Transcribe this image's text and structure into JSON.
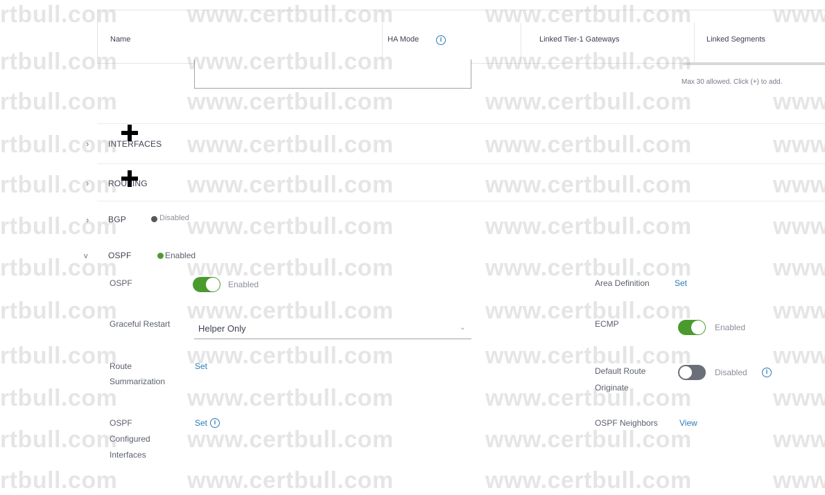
{
  "table_header": {
    "name": "Name",
    "ha_mode": "HA Mode",
    "linked_tier1": "Linked Tier-1 Gateways",
    "linked_segments": "Linked Segments"
  },
  "hint": "Max 30 allowed. Click (+) to add.",
  "sections": {
    "interfaces": "INTERFACES",
    "routing": "ROUTING",
    "bgp": {
      "title": "BGP",
      "status": "Disabled"
    },
    "ospf": {
      "title": "OSPF",
      "status": "Enabled"
    }
  },
  "ospf_form": {
    "ospf_label": "OSPF",
    "ospf_toggle": "Enabled",
    "graceful_label": "Graceful Restart",
    "graceful_value": "Helper Only",
    "route_label_1": "Route",
    "route_label_2": "Summarization",
    "route_link": "Set",
    "configured_label_1": "OSPF",
    "configured_label_2": "Configured",
    "configured_label_3": "Interfaces",
    "configured_link": "Set",
    "area_label": "Area Definition",
    "area_link": "Set",
    "ecmp_label": "ECMP",
    "ecmp_toggle": "Enabled",
    "default_label_1": "Default Route",
    "default_label_2": "Originate",
    "default_toggle": "Disabled",
    "neighbors_label": "OSPF Neighbors",
    "neighbors_link": "View"
  },
  "watermark": "www.certbull.com",
  "watermark_left": "rtbull.com",
  "watermark_right": "www",
  "colors": {
    "enabled": "#4a9a2e",
    "disabled": "#6b6f77",
    "link": "#2a7bb5"
  }
}
